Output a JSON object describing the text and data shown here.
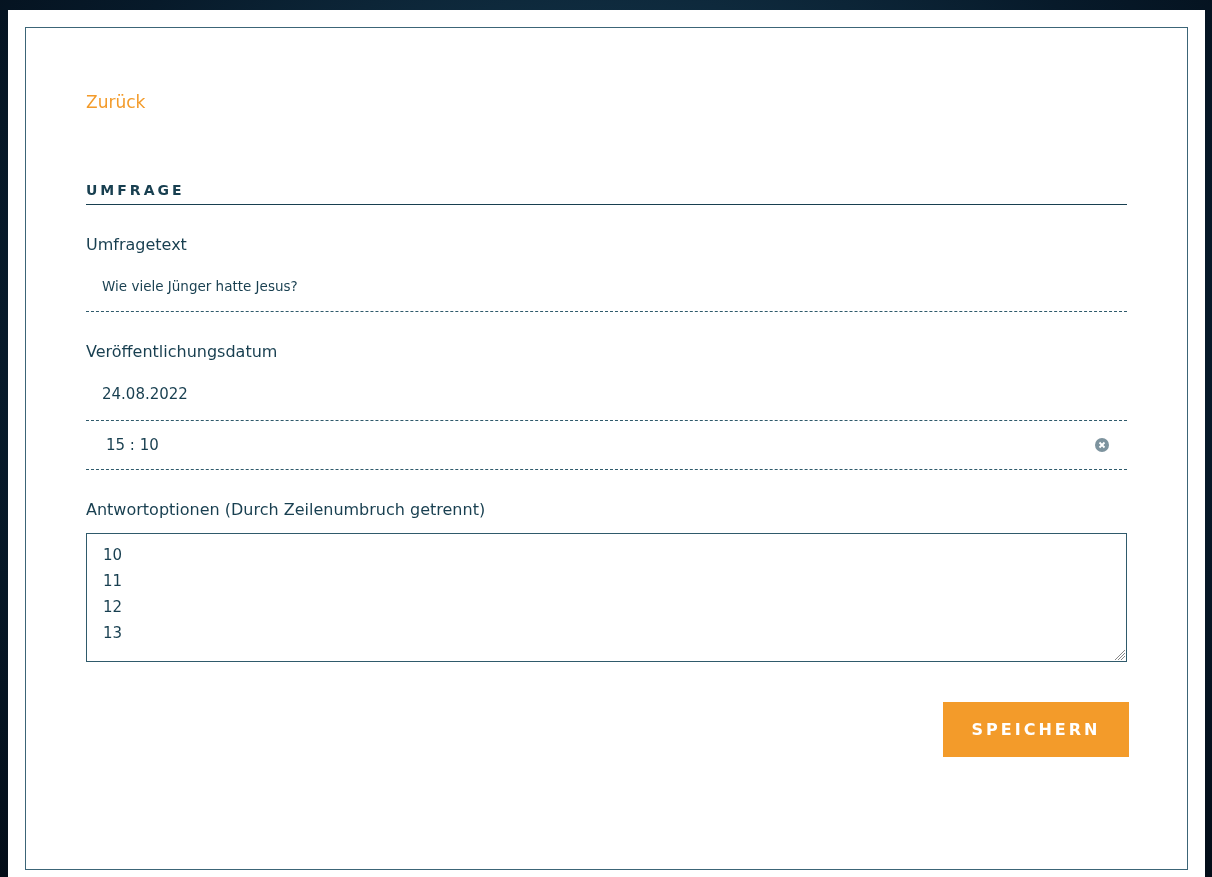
{
  "back_link": "Zurück",
  "section_title": "UMFRAGE",
  "fields": [
    {
      "kind": "text",
      "label": "Umfragetext",
      "value": "Wie viele Jünger hatte Jesus?"
    },
    {
      "kind": "date",
      "label": "Veröffentlichungsdatum",
      "value": "24.08.2022"
    },
    {
      "kind": "time",
      "value": "15 : 10"
    },
    {
      "kind": "textarea",
      "label": "Antwortoptionen (Durch Zeilenumbruch getrennt)",
      "lines": [
        "10",
        "11",
        "12",
        "13"
      ]
    }
  ],
  "buttons": [
    "SPEICHERN"
  ]
}
